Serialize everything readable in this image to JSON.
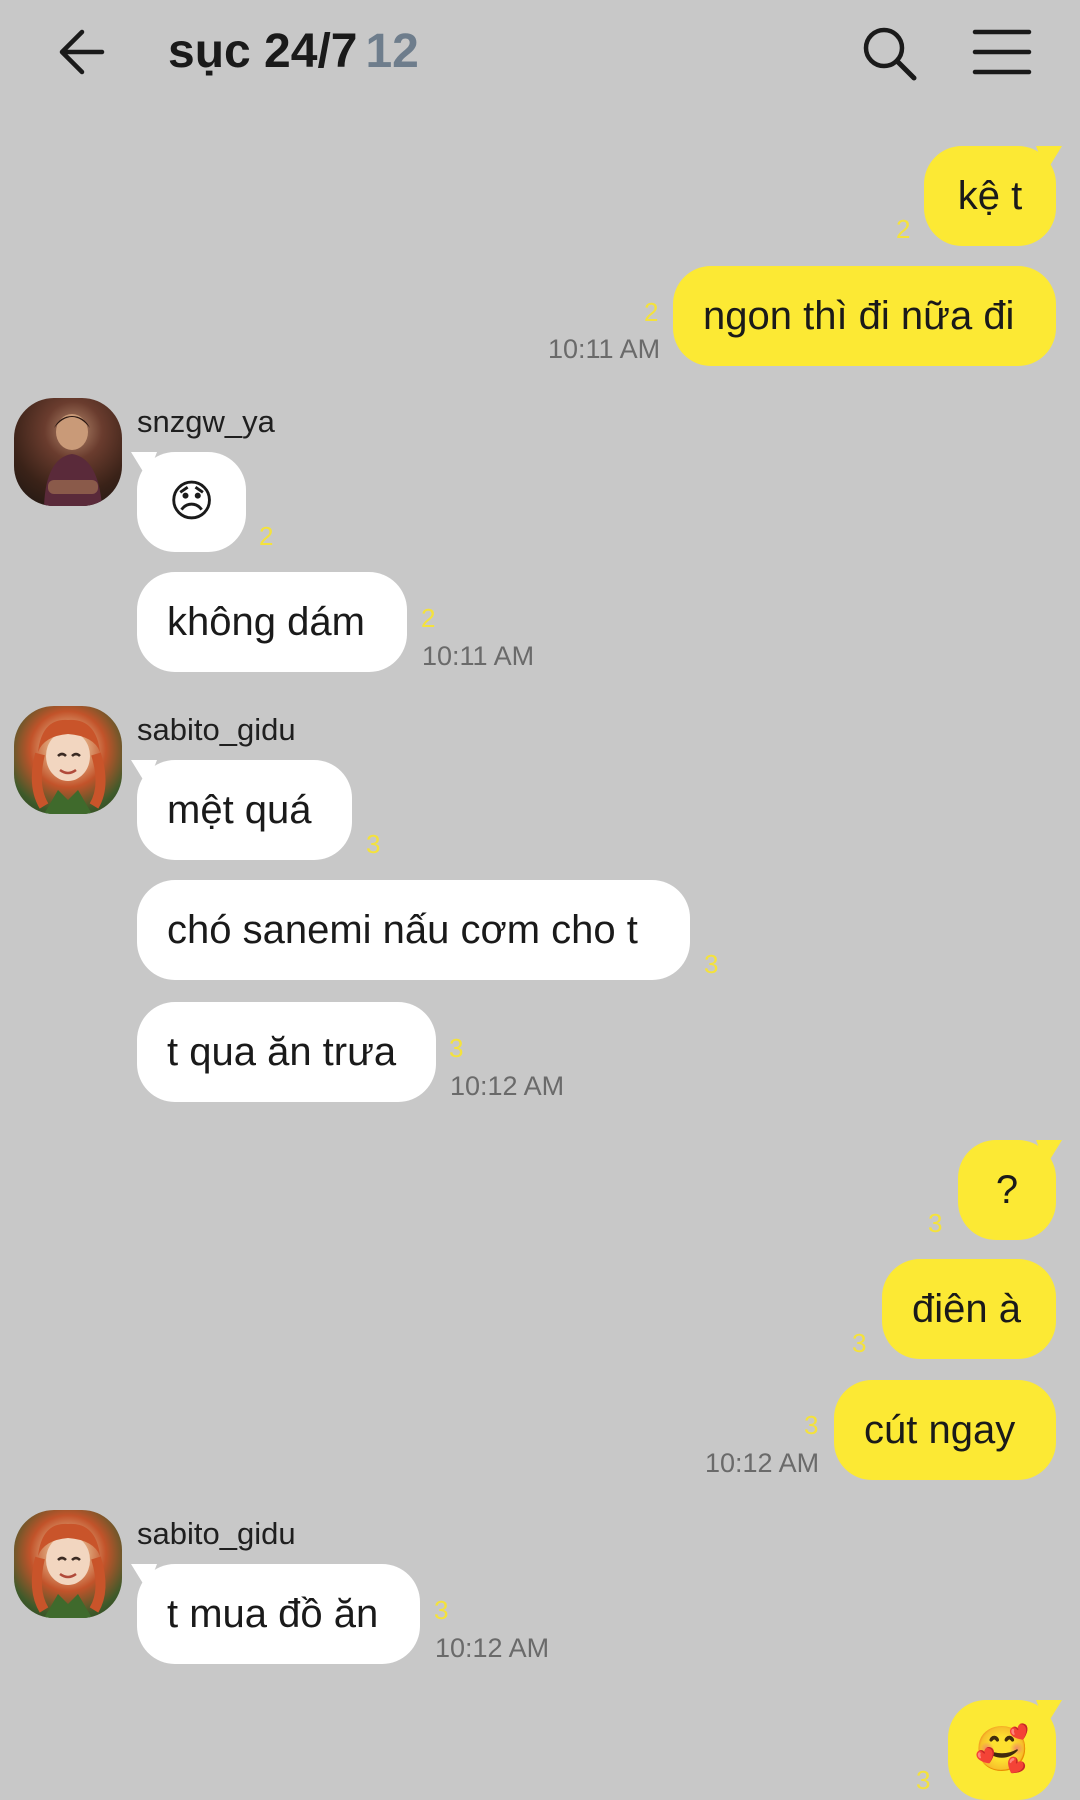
{
  "header": {
    "title": "sục 24/7",
    "member_count": "12"
  },
  "icons": {
    "back": "arrow-left-icon",
    "search": "search-icon",
    "menu": "hamburger-menu-icon"
  },
  "colors": {
    "background": "#c8c8c8",
    "my_bubble": "#fce934",
    "other_bubble": "#ffffff",
    "unread": "#f4e23c",
    "member_count": "#6e7d8c"
  },
  "messages": [
    {
      "sender": "me",
      "text": "kệ t",
      "unread": "2"
    },
    {
      "sender": "me",
      "text": "ngon thì đi nữa đi",
      "unread": "2",
      "time": "10:11 AM"
    },
    {
      "sender": "snzgw_ya",
      "text": "😞",
      "unread": "2"
    },
    {
      "sender": "snzgw_ya",
      "text": "không dám",
      "unread": "2",
      "time": "10:11 AM"
    },
    {
      "sender": "sabito_gidu",
      "text": "mệt quá",
      "unread": "3"
    },
    {
      "sender": "sabito_gidu",
      "text": "chó sanemi nấu cơm cho t",
      "unread": "3"
    },
    {
      "sender": "sabito_gidu",
      "text": "t qua ăn trưa",
      "unread": "3",
      "time": "10:12 AM"
    },
    {
      "sender": "me",
      "text": "?",
      "unread": "3"
    },
    {
      "sender": "me",
      "text": "điên à",
      "unread": "3"
    },
    {
      "sender": "me",
      "text": "cút ngay",
      "unread": "3",
      "time": "10:12 AM"
    },
    {
      "sender": "sabito_gidu",
      "text": "t mua đồ ăn",
      "unread": "3",
      "time": "10:12 AM"
    },
    {
      "sender": "me",
      "text": "🥰",
      "unread": "3"
    }
  ],
  "groups": [
    {
      "sender_name": "snzgw_ya",
      "avatar": "avatar-snzgw_ya"
    },
    {
      "sender_name": "sabito_gidu",
      "avatar": "avatar-sabito_gidu"
    },
    {
      "sender_name": "sabito_gidu",
      "avatar": "avatar-sabito_gidu"
    }
  ]
}
